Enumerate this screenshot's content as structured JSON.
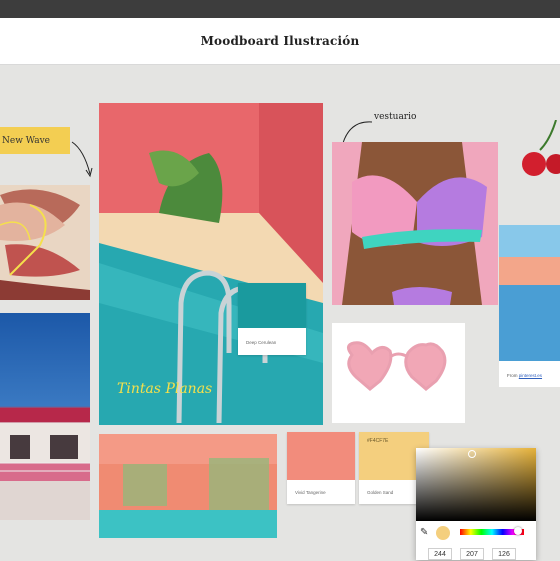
{
  "app": {
    "title": "Moodboard Ilustración"
  },
  "notes": {
    "new_wave": "New Wave",
    "vestuario": "vestuario",
    "tintas_planas": "Tintas Planas"
  },
  "swatches": {
    "deep_cerulean": {
      "name": "Deep Cerulean",
      "color": "#1a9a9e"
    },
    "vivid_tangerine": {
      "name": "Vivid Tangerine",
      "color": "#f28c7c"
    },
    "golden_sand": {
      "name": "Golden Sand",
      "color": "#f4cf7e",
      "hex": "#F4CF7E"
    }
  },
  "photo_credit": {
    "prefix": "From",
    "link": "pinterest.es"
  },
  "picker": {
    "r": "244",
    "g": "207",
    "b": "126",
    "current_color": "#f4cf7e"
  },
  "icons": {
    "eyedropper": "eyedropper-icon",
    "hue_slider": "hue-slider"
  }
}
